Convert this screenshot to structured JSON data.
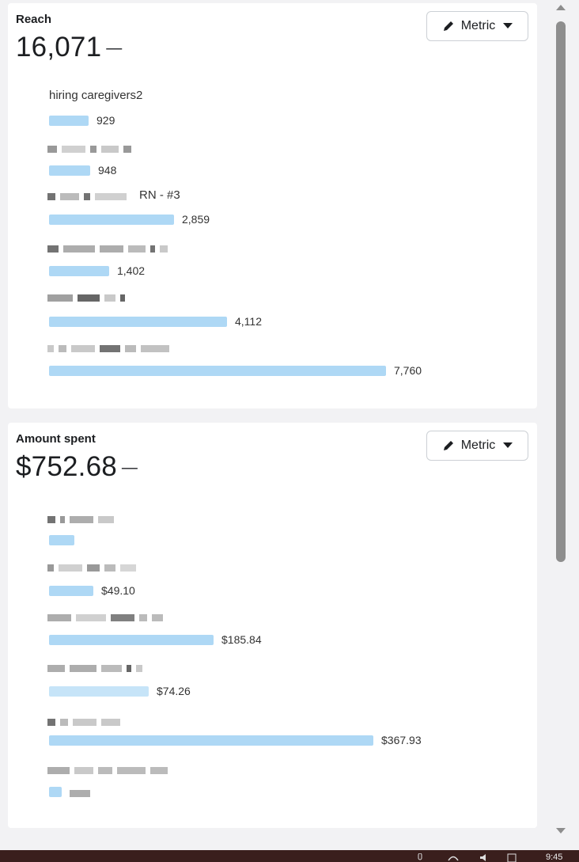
{
  "cards": {
    "reach": {
      "title": "Reach",
      "value": "16,071",
      "trend": "—",
      "metric_button": "Metric",
      "rows": [
        {
          "label": "hiring caregivers2",
          "value": "929",
          "fraction": 0.12
        },
        {
          "label": "",
          "value": "948",
          "fraction": 0.12
        },
        {
          "label": "RN - #3",
          "value": "2,859",
          "fraction": 0.37
        },
        {
          "label": "",
          "value": "1,402",
          "fraction": 0.18
        },
        {
          "label": "",
          "value": "4,112",
          "fraction": 0.53
        },
        {
          "label": "",
          "value": "7,760",
          "fraction": 1.0
        }
      ]
    },
    "spent": {
      "title": "Amount spent",
      "value": "$752.68",
      "trend": "—",
      "metric_button": "Metric",
      "rows": [
        {
          "label": "",
          "value": "",
          "fraction": 0.07
        },
        {
          "label": "",
          "value": "$49.10",
          "fraction": 0.13
        },
        {
          "label": "",
          "value": "$185.84",
          "fraction": 0.5
        },
        {
          "label": "",
          "value": "$74.26",
          "fraction": 0.3
        },
        {
          "label": "",
          "value": "$367.93",
          "fraction": 1.0
        },
        {
          "label": "",
          "value": "",
          "fraction": 0.04
        }
      ]
    }
  },
  "taskbar": {
    "time": "9:45"
  }
}
